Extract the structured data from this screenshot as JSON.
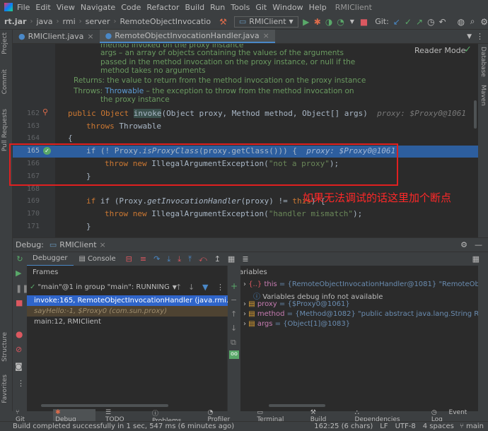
{
  "menu": [
    "File",
    "Edit",
    "View",
    "Navigate",
    "Code",
    "Refactor",
    "Build",
    "Run",
    "Tools",
    "Git",
    "Window",
    "Help"
  ],
  "app_title": "RMIClient",
  "breadcrumb": [
    "rt.jar",
    "java",
    "rmi",
    "server",
    "RemoteObjectInvocatio"
  ],
  "run_config": "RMIClient",
  "git_label": "Git:",
  "editor_tabs": [
    "RMIClient.java",
    "RemoteObjectInvocationHandler.java"
  ],
  "reader_mode": "Reader Mode",
  "doc": {
    "l1": "method invoked on the proxy instance",
    "l2": "args – an array of objects containing the values of the arguments",
    "l3": "passed in the method invocation on the proxy instance, or null if the",
    "l4": "method takes no arguments",
    "returns": "Returns: the value to return from the method invocation on the proxy instance",
    "throws_a": "Throws: ",
    "throws_b": "Throwable",
    "throws_c": " – the exception to throw from the method invocation on",
    "l7": "the proxy instance"
  },
  "code": {
    "n162": "162",
    "n163": "163",
    "n164": "164",
    "n165": "165",
    "n166": "166",
    "n167": "167",
    "n168": "168",
    "n169": "169",
    "n170": "170",
    "n171": "171",
    "c162a": "public Object ",
    "c162b": "invoke",
    "c162c": "(Object proxy, Method method, Object[] args)",
    "h162": "proxy: $Proxy0@1061   me",
    "c163a": "throws ",
    "c163b": "Throwable",
    "c164": "{",
    "c165a": "if (! Proxy.",
    "c165b": "isProxyClass",
    "c165c": "(proxy.getClass())) {",
    "h165": "proxy: $Proxy0@1061",
    "c166a": "throw new ",
    "c166b": "IllegalArgumentException(",
    "c166c": "\"not a proxy\"",
    "c166d": ");",
    "c167": "}",
    "c169a": "if (Proxy.",
    "c169b": "getInvocationHandler",
    "c169c": "(proxy) != ",
    "c169d": "this",
    "c169e": ") {",
    "c170a": "throw new ",
    "c170b": "IllegalArgumentException(",
    "c170c": "\"handler mismatch\"",
    "c170d": ");",
    "c171": "}"
  },
  "annotation": "如果无法调试的话这里加个断点",
  "debug": {
    "label": "Debug:",
    "session": "RMIClient",
    "tab_debugger": "Debugger",
    "tab_console": "Console",
    "frames_title": "Frames",
    "vars_title": "Variables",
    "thread": "\"main\"@1 in group \"main\": RUNNING",
    "frames": [
      "invoke:165, RemoteObjectInvocationHandler (java.rmi.server)",
      "sayHello:-1, $Proxy0 (com.sun.proxy)",
      "main:12, RMIClient"
    ],
    "vars": [
      {
        "name": "this",
        "value": " = {RemoteObjectInvocationHandler@1081} \"RemoteObjectInvoca"
      },
      {
        "name": "",
        "value": "Variables debug info not available"
      },
      {
        "name": "proxy",
        "value": " = {$Proxy0@1061}"
      },
      {
        "name": "method",
        "value": " = {Method@1082} \"public abstract java.lang.String RemoteOb"
      },
      {
        "name": "args",
        "value": " = {Object[1]@1083}"
      }
    ]
  },
  "bottom_tabs": [
    "Git",
    "Debug",
    "TODO",
    "Problems",
    "Profiler",
    "Terminal",
    "Build",
    "Dependencies",
    "Event Log"
  ],
  "status": {
    "message": "Build completed successfully in 1 sec, 547 ms (6 minutes ago)",
    "position": "162:25 (6 chars)",
    "le": "LF",
    "enc": "UTF-8",
    "indent": "4 spaces",
    "branch": "main"
  },
  "side": {
    "project": "Project",
    "commit": "Commit",
    "pull": "Pull Requests",
    "structure": "Structure",
    "favorites": "Favorites",
    "database": "Database",
    "maven": "Maven"
  },
  "colors": {
    "accent": "#4a88c7",
    "exec_line": "#2d5e9e",
    "annotation": "#ff2828"
  }
}
